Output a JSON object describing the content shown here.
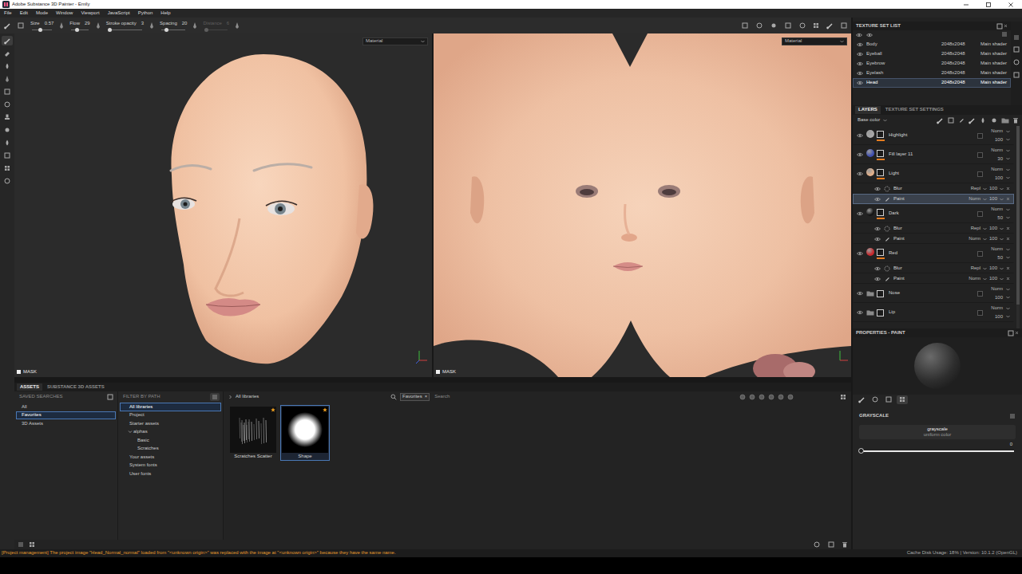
{
  "window": {
    "title": "Adobe Substance 3D Painter - Emily"
  },
  "menu": [
    "File",
    "Edit",
    "Mode",
    "Window",
    "Viewport",
    "JavaScript",
    "Python",
    "Help"
  ],
  "tool_options": [
    {
      "label": "Size",
      "value": "0.57",
      "level": 0.4,
      "disabled": false
    },
    {
      "label": "Flow",
      "value": "29",
      "level": 0.29,
      "disabled": false
    },
    {
      "label": "Stroke opacity",
      "value": "3",
      "level": 0.05,
      "disabled": false
    },
    {
      "label": "Spacing",
      "value": "20",
      "level": 0.2,
      "disabled": false
    },
    {
      "label": "Distance",
      "value": "6",
      "level": 0.06,
      "disabled": true
    }
  ],
  "tools": [
    {
      "selected": true
    },
    {
      "selected": false
    },
    {
      "selected": false
    },
    {
      "selected": false
    },
    {
      "selected": false
    },
    {
      "selected": false
    },
    {
      "selected": false
    },
    {
      "selected": false
    },
    {
      "selected": false
    },
    {
      "selected": false
    },
    {
      "selected": false
    },
    {
      "selected": false
    }
  ],
  "viewports": [
    {
      "kind": "3d",
      "dropdown": "Material",
      "mask": "MASK"
    },
    {
      "kind": "uv",
      "dropdown": "Material",
      "mask": "MASK"
    }
  ],
  "texture_sets": {
    "title": "TEXTURE SET LIST",
    "items": [
      {
        "name": "Body",
        "resolution": "2048x2048",
        "shader": "Main shader",
        "selected": false
      },
      {
        "name": "Eyeball",
        "resolution": "2048x2048",
        "shader": "Main shader",
        "selected": false
      },
      {
        "name": "Eyebrow",
        "resolution": "2048x2048",
        "shader": "Main shader",
        "selected": false
      },
      {
        "name": "Eyelash",
        "resolution": "2048x2048",
        "shader": "Main shader",
        "selected": false
      },
      {
        "name": "Head",
        "resolution": "2048x2048",
        "shader": "Main shader",
        "selected": true
      }
    ]
  },
  "layers": {
    "tabs": [
      {
        "label": "LAYERS",
        "selected": true
      },
      {
        "label": "TEXTURE SET SETTINGS",
        "selected": false
      }
    ],
    "channel": "Base color",
    "items": [
      {
        "name": "Highlight",
        "kind": "layer",
        "blend": "Norm",
        "opacity": "100",
        "color": "#a8a8a8",
        "selected": false
      },
      {
        "name": "Fill layer 11",
        "kind": "layer",
        "blend": "Norm",
        "opacity": "30",
        "color": "#3f4fb0",
        "selected": false
      },
      {
        "name": "Light",
        "kind": "layer",
        "blend": "Norm",
        "opacity": "100",
        "color": "#e3b08a",
        "selected": false
      },
      {
        "name": "Blur",
        "kind": "effect",
        "blend": "Repl",
        "opacity": "100",
        "selected": false
      },
      {
        "name": "Paint",
        "kind": "paint",
        "blend": "Norm",
        "opacity": "100",
        "selected": true
      },
      {
        "name": "Dark",
        "kind": "layer",
        "blend": "Norm",
        "opacity": "50",
        "color": "#151515",
        "selected": false
      },
      {
        "name": "Blur",
        "kind": "effect",
        "blend": "Repl",
        "opacity": "100",
        "selected": false
      },
      {
        "name": "Paint",
        "kind": "paint",
        "blend": "Norm",
        "opacity": "100",
        "selected": false
      },
      {
        "name": "Red",
        "kind": "layer",
        "blend": "Norm",
        "opacity": "50",
        "color": "#c8282c",
        "selected": false
      },
      {
        "name": "Blur",
        "kind": "effect",
        "blend": "Repl",
        "opacity": "100",
        "selected": false
      },
      {
        "name": "Paint",
        "kind": "paint",
        "blend": "Norm",
        "opacity": "100",
        "selected": false
      },
      {
        "name": "Nose",
        "kind": "folder",
        "blend": "Norm",
        "opacity": "100",
        "selected": false
      },
      {
        "name": "Lip",
        "kind": "folder",
        "blend": "Norm",
        "opacity": "100",
        "selected": false
      }
    ]
  },
  "properties": {
    "title": "PROPERTIES - PAINT",
    "tabs": [
      {
        "selected": false
      },
      {
        "selected": false
      },
      {
        "selected": false
      },
      {
        "selected": true
      }
    ],
    "section": "GRAYSCALE",
    "param": "grayscale",
    "param_note": "uniform color",
    "value": "0",
    "level": 0
  },
  "assets": {
    "tabs": [
      {
        "label": "ASSETS",
        "selected": true
      },
      {
        "label": "SUBSTANCE 3D ASSETS",
        "selected": false
      }
    ],
    "saved_searches": {
      "title": "SAVED SEARCHES",
      "items": [
        {
          "label": "All",
          "selected": false
        },
        {
          "label": "Favorites",
          "selected": true
        },
        {
          "label": "3D Assets",
          "selected": false
        }
      ]
    },
    "filter": {
      "title": "FILTER BY PATH",
      "items": [
        {
          "label": "All libraries",
          "depth": 0,
          "expanded": false,
          "selected": true
        },
        {
          "label": "Project",
          "depth": 0,
          "expanded": false,
          "selected": false
        },
        {
          "label": "Starter assets",
          "depth": 0,
          "expanded": false,
          "selected": false
        },
        {
          "label": "alphas",
          "depth": 1,
          "expanded": true,
          "selected": false
        },
        {
          "label": "Basic",
          "depth": 2,
          "expanded": false,
          "selected": false
        },
        {
          "label": "Scratches",
          "depth": 2,
          "expanded": false,
          "selected": false
        },
        {
          "label": "Your assets",
          "depth": 0,
          "expanded": false,
          "selected": false
        },
        {
          "label": "System fonts",
          "depth": 0,
          "expanded": false,
          "selected": false
        },
        {
          "label": "User fonts",
          "depth": 0,
          "expanded": false,
          "selected": false
        }
      ]
    },
    "breadcrumb": "All libraries",
    "search": {
      "tag": "Favorites",
      "tag_close": "×",
      "placeholder": "Search"
    },
    "thumbnails": [
      {
        "label": "Scratches Scatter",
        "kind": "scratches",
        "starred": true,
        "selected": false
      },
      {
        "label": "Shape",
        "kind": "shape",
        "starred": true,
        "selected": true
      }
    ]
  },
  "status_bar": {
    "message": "[Project management] The project image \"Head_Normal_normal\" loaded from \"<unknown origin>\" was replaced with the image at \"<unknown origin>\" because they have the same name.",
    "info": "Cache Disk Usage:  18% | Version: 10.1.2 (OpenGL)"
  }
}
